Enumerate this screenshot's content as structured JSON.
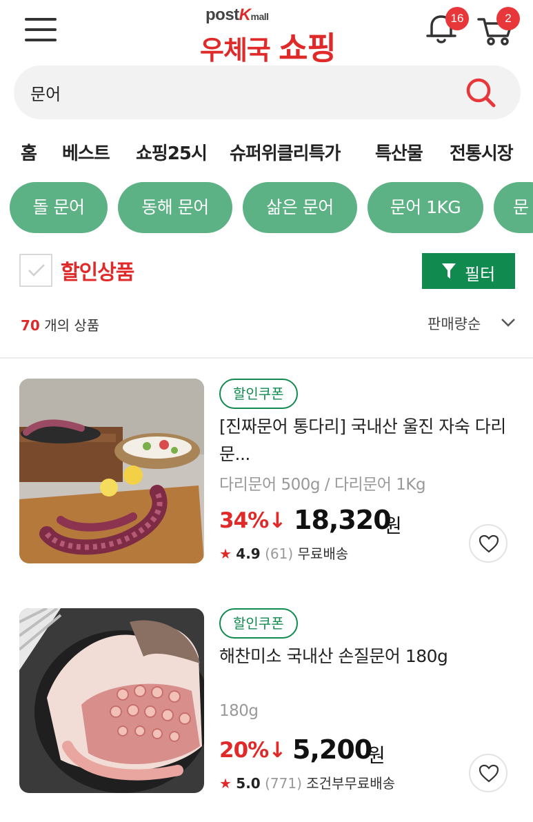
{
  "header": {
    "logo_sub_post": "post",
    "logo_sub_k": "K",
    "logo_sub_mall": "mall",
    "logo_main_1": "우체국 ",
    "logo_main_2": "쇼핑",
    "notification_count": "16",
    "cart_count": "2"
  },
  "search": {
    "value": "문어"
  },
  "nav": [
    "홈",
    "베스트",
    "쇼핑25시",
    "슈퍼위클리특가",
    "특산물",
    "전통시장"
  ],
  "chips": [
    "돌 문어",
    "동해 문어",
    "삶은 문어",
    "문어 1KG",
    "문"
  ],
  "filter": {
    "discount_label": "할인상품",
    "filter_button": "필터"
  },
  "results": {
    "count": "70",
    "count_suffix": " 개의 상품",
    "sort": "판매량순"
  },
  "products": [
    {
      "coupon": "할인쿠폰",
      "name": "[진짜문어 통다리] 국내산 울진 자숙 다리문...",
      "options": "다리문어 500g / 다리문어 1Kg",
      "discount": "34%↓",
      "price": "18,320",
      "currency": "원",
      "star": "★",
      "rating": "4.9",
      "reviews": "(61)",
      "shipping": "무료배송"
    },
    {
      "coupon": "할인쿠폰",
      "name": "해찬미소 국내산 손질문어 180g",
      "options": "180g",
      "discount": "20%↓",
      "price": "5,200",
      "currency": "원",
      "star": "★",
      "rating": "5.0",
      "reviews": "(771)",
      "shipping": "조건부무료배송"
    }
  ],
  "colors": {
    "brand_red": "#e02a2a",
    "chip_green": "#5db285",
    "filter_green": "#118a4f"
  }
}
